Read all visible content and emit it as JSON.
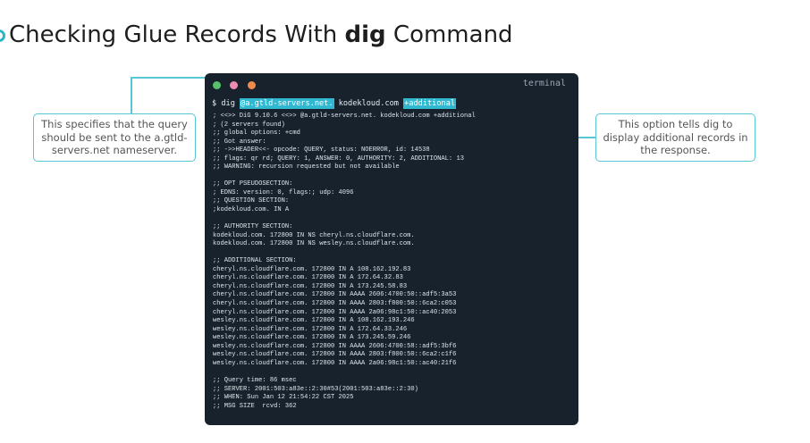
{
  "slide": {
    "title_prefix": "Checking Glue Records With ",
    "title_bold": "dig",
    "title_suffix": " Command"
  },
  "terminal": {
    "window_label": "terminal",
    "command": {
      "prompt": "$ dig ",
      "server_arg": "@a.gtld-servers.net.",
      "domain_arg": " kodekloud.com ",
      "option_arg": "+additional"
    },
    "output_lines": [
      "; <<>> DiG 9.10.6 <<>> @a.gtld-servers.net. kodekloud.com +additional",
      "; (2 servers found)",
      ";; global options: +cmd",
      ";; Got answer:",
      ";; ->>HEADER<<- opcode: QUERY, status: NOERROR, id: 14538",
      ";; flags: qr rd; QUERY: 1, ANSWER: 0, AUTHORITY: 2, ADDITIONAL: 13",
      ";; WARNING: recursion requested but not available",
      "",
      ";; OPT PSEUDOSECTION:",
      "; EDNS: version: 0, flags:; udp: 4096",
      ";; QUESTION SECTION:",
      ";kodekloud.com. IN A",
      "",
      ";; AUTHORITY SECTION:",
      "kodekloud.com. 172800 IN NS cheryl.ns.cloudflare.com.",
      "kodekloud.com. 172800 IN NS wesley.ns.cloudflare.com.",
      "",
      ";; ADDITIONAL SECTION:",
      "cheryl.ns.cloudflare.com. 172800 IN A 108.162.192.83",
      "cheryl.ns.cloudflare.com. 172800 IN A 172.64.32.83",
      "cheryl.ns.cloudflare.com. 172800 IN A 173.245.58.83",
      "cheryl.ns.cloudflare.com. 172800 IN AAAA 2606:4700:50::adf5:3a53",
      "cheryl.ns.cloudflare.com. 172800 IN AAAA 2803:f800:50::6ca2:c053",
      "cheryl.ns.cloudflare.com. 172800 IN AAAA 2a06:98c1:50::ac40:2053",
      "wesley.ns.cloudflare.com. 172800 IN A 108.162.193.246",
      "wesley.ns.cloudflare.com. 172800 IN A 172.64.33.246",
      "wesley.ns.cloudflare.com. 172800 IN A 173.245.59.246",
      "wesley.ns.cloudflare.com. 172800 IN AAAA 2606:4700:58::adf5:3bf6",
      "wesley.ns.cloudflare.com. 172800 IN AAAA 2803:f800:50::6ca2:c1f6",
      "wesley.ns.cloudflare.com. 172800 IN AAAA 2a06:98c1:50::ac40:21f6",
      "",
      ";; Query time: 86 msec",
      ";; SERVER: 2001:503:a83e::2:30#53(2001:503:a83e::2:30)",
      ";; WHEN: Sun Jan 12 21:54:22 CST 2025",
      ";; MSG SIZE  rcvd: 362"
    ]
  },
  "callouts": {
    "left": "This specifies that the query should be sent to the a.gtld-servers.net nameserver.",
    "right": "This option tells dig to display additional records in the response."
  },
  "colors": {
    "accent": "#2bb5c5",
    "terminal_bg": "#17222d",
    "highlight": "#2fb8cf"
  }
}
